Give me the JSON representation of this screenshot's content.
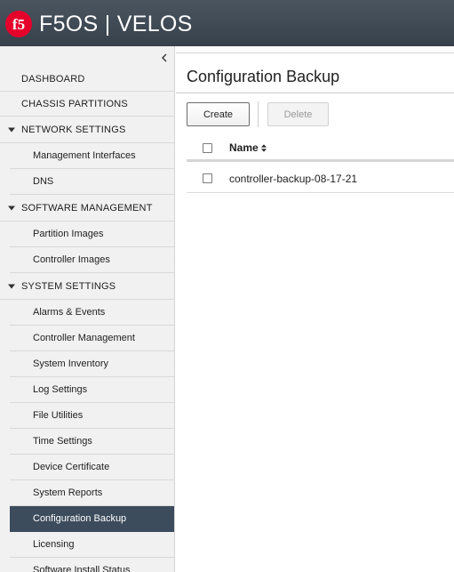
{
  "header": {
    "logo_text": "f5",
    "product_name": "F5OS | VELOS",
    "background_color": "#3e4852",
    "logo_color": "#e4002b"
  },
  "sidebar": {
    "collapse_icon": "chevron-left-icon",
    "items": [
      {
        "type": "top",
        "label": "DASHBOARD"
      },
      {
        "type": "top",
        "label": "CHASSIS PARTITIONS"
      },
      {
        "type": "section",
        "label": "NETWORK SETTINGS",
        "expanded": true
      },
      {
        "type": "sub",
        "label": "Management Interfaces"
      },
      {
        "type": "sub",
        "label": "DNS"
      },
      {
        "type": "section",
        "label": "SOFTWARE MANAGEMENT",
        "expanded": true
      },
      {
        "type": "sub",
        "label": "Partition Images"
      },
      {
        "type": "sub",
        "label": "Controller Images"
      },
      {
        "type": "section",
        "label": "SYSTEM SETTINGS",
        "expanded": true
      },
      {
        "type": "sub",
        "label": "Alarms & Events"
      },
      {
        "type": "sub",
        "label": "Controller Management"
      },
      {
        "type": "sub",
        "label": "System Inventory"
      },
      {
        "type": "sub",
        "label": "Log Settings"
      },
      {
        "type": "sub",
        "label": "File Utilities"
      },
      {
        "type": "sub",
        "label": "Time Settings"
      },
      {
        "type": "sub",
        "label": "Device Certificate"
      },
      {
        "type": "sub",
        "label": "System Reports"
      },
      {
        "type": "sub",
        "label": "Configuration Backup",
        "active": true
      },
      {
        "type": "sub",
        "label": "Licensing"
      },
      {
        "type": "sub",
        "label": "Software Install Status"
      }
    ],
    "active_color": "#3d4c5c"
  },
  "main": {
    "title": "Configuration Backup",
    "buttons": {
      "create_label": "Create",
      "delete_label": "Delete",
      "delete_enabled": false
    },
    "table": {
      "columns": [
        {
          "label": "Name",
          "sortable": true,
          "sort_icon": "sort-icon"
        }
      ],
      "rows": [
        {
          "name": "controller-backup-08-17-21",
          "checked": false
        }
      ]
    }
  }
}
